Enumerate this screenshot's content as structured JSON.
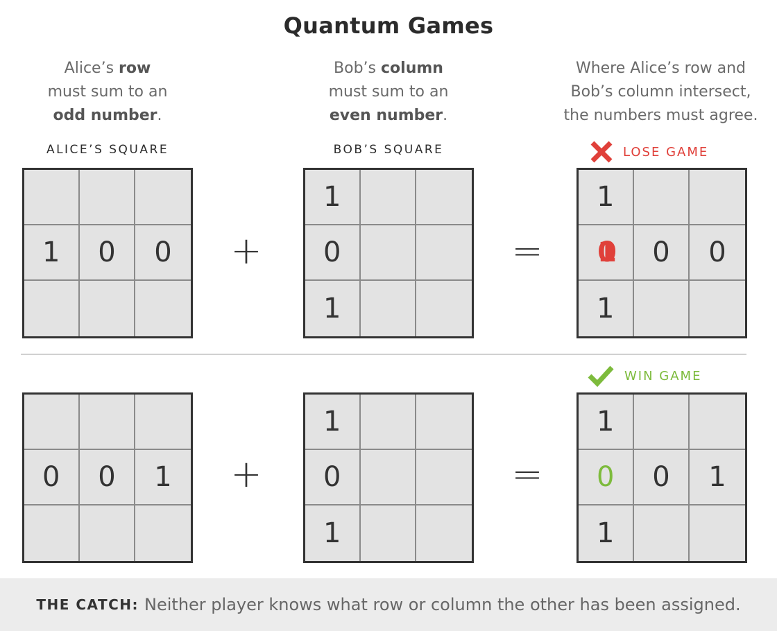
{
  "title": "Quantum Games",
  "rules": {
    "alice": {
      "pre": "Alice’s ",
      "bold1": "row",
      "mid": "must sum to an",
      "bold2": "odd number",
      "post": "."
    },
    "bob": {
      "pre": "Bob’s ",
      "bold1": "column",
      "mid": "must sum to an",
      "bold2": "even number",
      "post": "."
    },
    "intersect": {
      "line1": "Where Alice’s row and",
      "line2": "Bob’s column intersect,",
      "line3": "the numbers must agree."
    }
  },
  "labels": {
    "alice_square": "ALICE’S SQUARE",
    "bob_square": "BOB’S SQUARE"
  },
  "colors": {
    "lose": "#e0403a",
    "win": "#7dbb3c",
    "text": "#333333",
    "cell_bg": "#e3e3e3"
  },
  "rows": [
    {
      "status": {
        "icon": "x-icon",
        "text": "LOSE GAME"
      },
      "alice": [
        "",
        "",
        "",
        "1",
        "0",
        "0",
        "",
        "",
        ""
      ],
      "bob": [
        "1",
        "",
        "",
        "0",
        "",
        "",
        "1",
        "",
        ""
      ],
      "result": [
        "1",
        "",
        "",
        "1/0",
        "0",
        "0",
        "1",
        "",
        ""
      ],
      "operator_plus": "+",
      "operator_equals": "="
    },
    {
      "status": {
        "icon": "check-icon",
        "text": "WIN GAME"
      },
      "alice": [
        "",
        "",
        "",
        "0",
        "0",
        "1",
        "",
        "",
        ""
      ],
      "bob": [
        "1",
        "",
        "",
        "0",
        "",
        "",
        "1",
        "",
        ""
      ],
      "result": [
        "1",
        "",
        "",
        "0",
        "0",
        "1",
        "1",
        "",
        ""
      ],
      "operator_plus": "+",
      "operator_equals": "="
    }
  ],
  "footer": {
    "catch_label": "THE CATCH:",
    "text": "Neither player knows what row or column the other has been assigned."
  }
}
